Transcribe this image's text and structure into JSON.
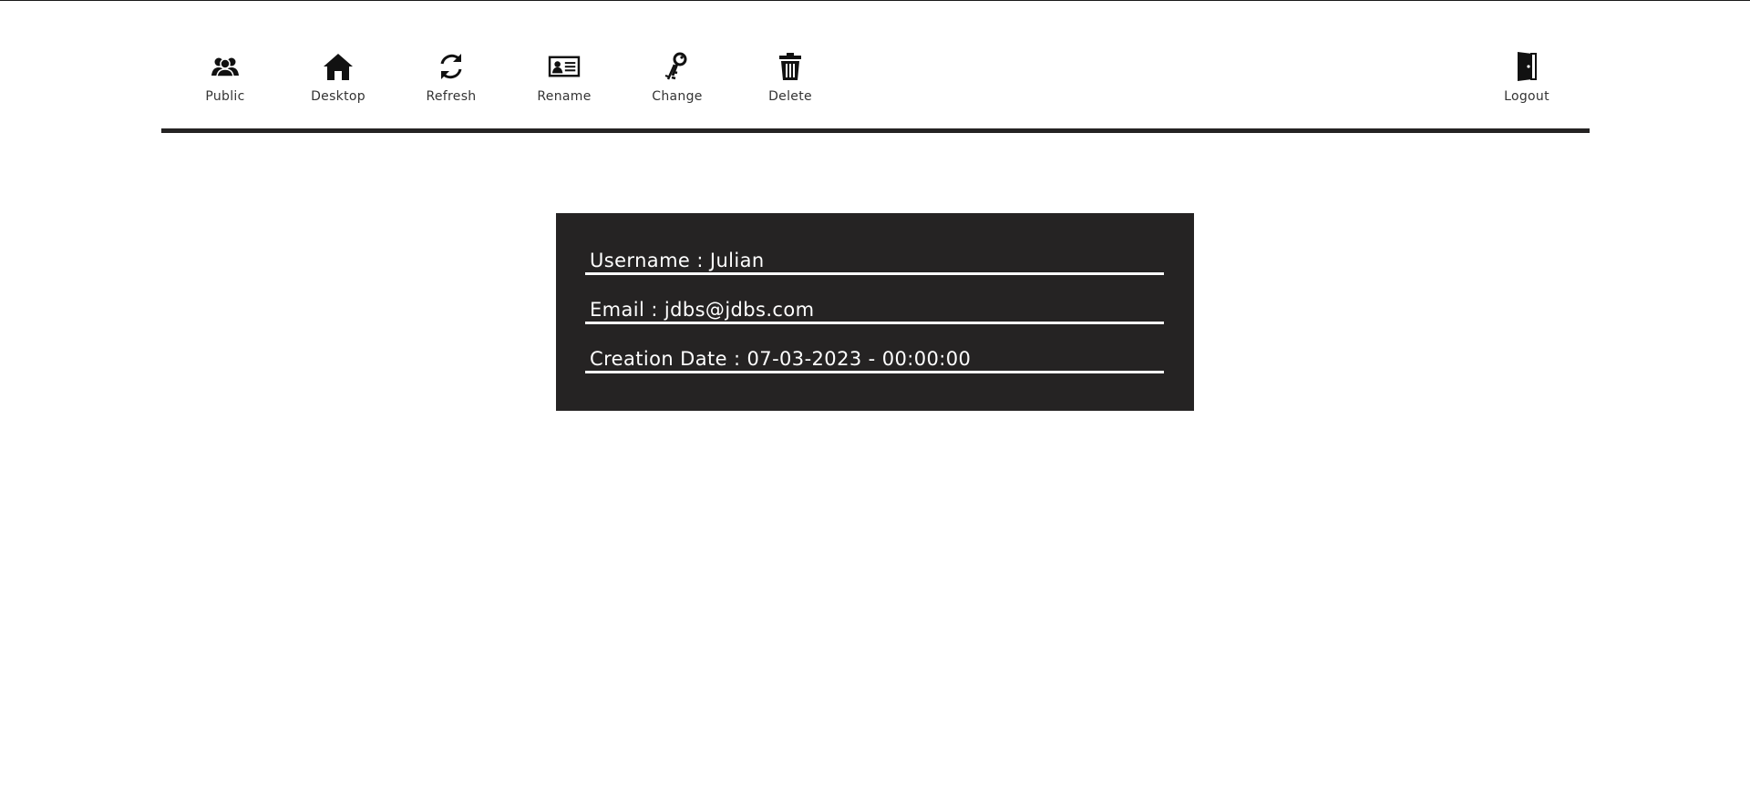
{
  "toolbar": {
    "items": [
      {
        "label": "Public",
        "icon": "users-icon"
      },
      {
        "label": "Desktop",
        "icon": "home-icon"
      },
      {
        "label": "Refresh",
        "icon": "refresh-icon"
      },
      {
        "label": "Rename",
        "icon": "id-card-icon"
      },
      {
        "label": "Change",
        "icon": "keys-icon"
      },
      {
        "label": "Delete",
        "icon": "trash-icon"
      }
    ],
    "logout": {
      "label": "Logout",
      "icon": "door-icon"
    }
  },
  "profile": {
    "username": "Username : Julian",
    "email": "Email : jdbs@jdbs.com",
    "creation_date": "Creation Date : 07-03-2023 - 00:00:00"
  },
  "colors": {
    "card_background": "#252323",
    "card_text": "#ffffff",
    "toolbar_rule": "#252323"
  }
}
